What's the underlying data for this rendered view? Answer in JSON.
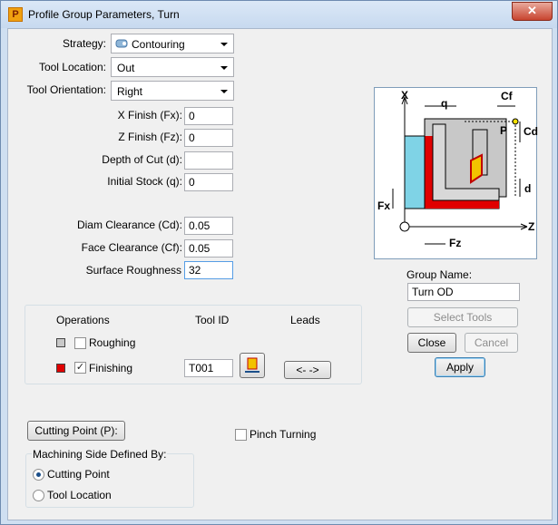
{
  "window": {
    "title": "Profile Group Parameters, Turn",
    "close_glyph": "✕"
  },
  "strategy": {
    "label": "Strategy:",
    "value": "Contouring"
  },
  "tool_location": {
    "label": "Tool Location:",
    "value": "Out"
  },
  "tool_orientation": {
    "label": "Tool Orientation:",
    "value": "Right"
  },
  "x_finish": {
    "label": "X Finish (Fx):",
    "value": "0"
  },
  "z_finish": {
    "label": "Z Finish (Fz):",
    "value": "0"
  },
  "depth_of_cut": {
    "label": "Depth of Cut (d):",
    "value": ""
  },
  "initial_stock": {
    "label": "Initial Stock (q):",
    "value": "0"
  },
  "diam_clearance": {
    "label": "Diam Clearance (Cd):",
    "value": "0.05"
  },
  "face_clearance": {
    "label": "Face Clearance (Cf):",
    "value": "0.05"
  },
  "surface_roughness": {
    "label": "Surface Roughness",
    "value": "32"
  },
  "operations": {
    "col_operations": "Operations",
    "col_tool_id": "Tool ID",
    "col_leads": "Leads",
    "roughing": {
      "label": "Roughing",
      "checked": false,
      "swatch": "#c8c8c8"
    },
    "finishing": {
      "label": "Finishing",
      "checked": true,
      "swatch": "#e00000",
      "tool_id": "T001",
      "leads_label": "<- ->"
    }
  },
  "group_name": {
    "label": "Group Name:",
    "value": "Turn OD"
  },
  "buttons": {
    "select_tools": "Select Tools",
    "close": "Close",
    "cancel": "Cancel",
    "apply": "Apply",
    "cutting_point": "Cutting Point (P):"
  },
  "pinch_turning": {
    "label": "Pinch Turning",
    "checked": false
  },
  "machining_side": {
    "title": "Machining Side Defined By:",
    "opt_cutting_point": "Cutting Point",
    "opt_tool_location": "Tool Location",
    "selected": "Cutting Point"
  },
  "diagram": {
    "x_axis": "X",
    "z_axis": "Z",
    "q": "q",
    "cf": "Cf",
    "cd": "Cd",
    "p": "P",
    "d": "d",
    "fx": "Fx",
    "fz": "Fz"
  },
  "colors": {
    "stock": "#7fd3e6",
    "finish": "#e00000",
    "insert": "#f2c200"
  }
}
